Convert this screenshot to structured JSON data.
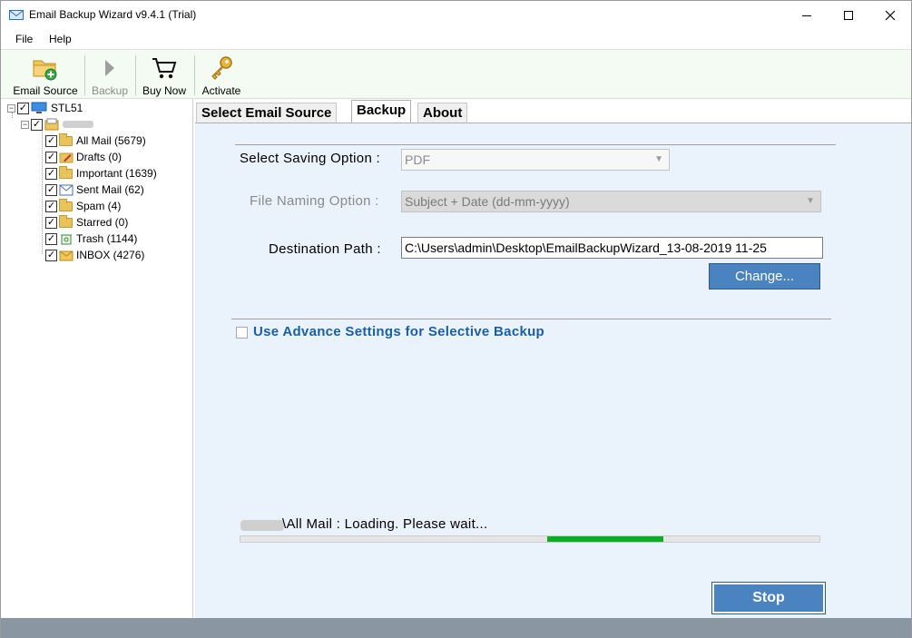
{
  "window": {
    "title": "Email Backup Wizard v9.4.1 (Trial)",
    "minimize_icon": "minimize-icon",
    "maximize_icon": "maximize-icon",
    "close_icon": "close-icon"
  },
  "menu": {
    "file": "File",
    "help": "Help"
  },
  "toolbar": {
    "email_source": "Email Source",
    "backup": "Backup",
    "buy_now": "Buy Now",
    "activate": "Activate"
  },
  "tree": {
    "root": "STL51",
    "items": [
      {
        "label": "All Mail (5679)",
        "icon": "folder-icon"
      },
      {
        "label": "Drafts (0)",
        "icon": "drafts-folder-icon"
      },
      {
        "label": "Important (1639)",
        "icon": "folder-icon"
      },
      {
        "label": "Sent Mail (62)",
        "icon": "sent-folder-icon"
      },
      {
        "label": "Spam (4)",
        "icon": "folder-icon"
      },
      {
        "label": "Starred (0)",
        "icon": "folder-icon"
      },
      {
        "label": "Trash (1144)",
        "icon": "trash-icon"
      },
      {
        "label": "INBOX (4276)",
        "icon": "inbox-icon"
      }
    ]
  },
  "tabs": {
    "select_source": "Select Email Source",
    "backup": "Backup",
    "about": "About"
  },
  "form": {
    "saving_label": "Select Saving Option :",
    "saving_value": "PDF",
    "naming_label": "File Naming Option :",
    "naming_value": "Subject + Date (dd-mm-yyyy)",
    "dest_label": "Destination Path :",
    "dest_value": "C:\\Users\\admin\\Desktop\\EmailBackupWizard_13-08-2019 11-25",
    "change_button": "Change...",
    "advance_label": "Use Advance Settings for Selective Backup"
  },
  "status": {
    "text": "\\All Mail : Loading. Please wait...",
    "progress_start": 0.53,
    "progress_end": 0.73
  },
  "stop_button": "Stop",
  "colors": {
    "accent": "#4a83bf",
    "progress": "#06b025",
    "link": "#1a5fa6"
  }
}
